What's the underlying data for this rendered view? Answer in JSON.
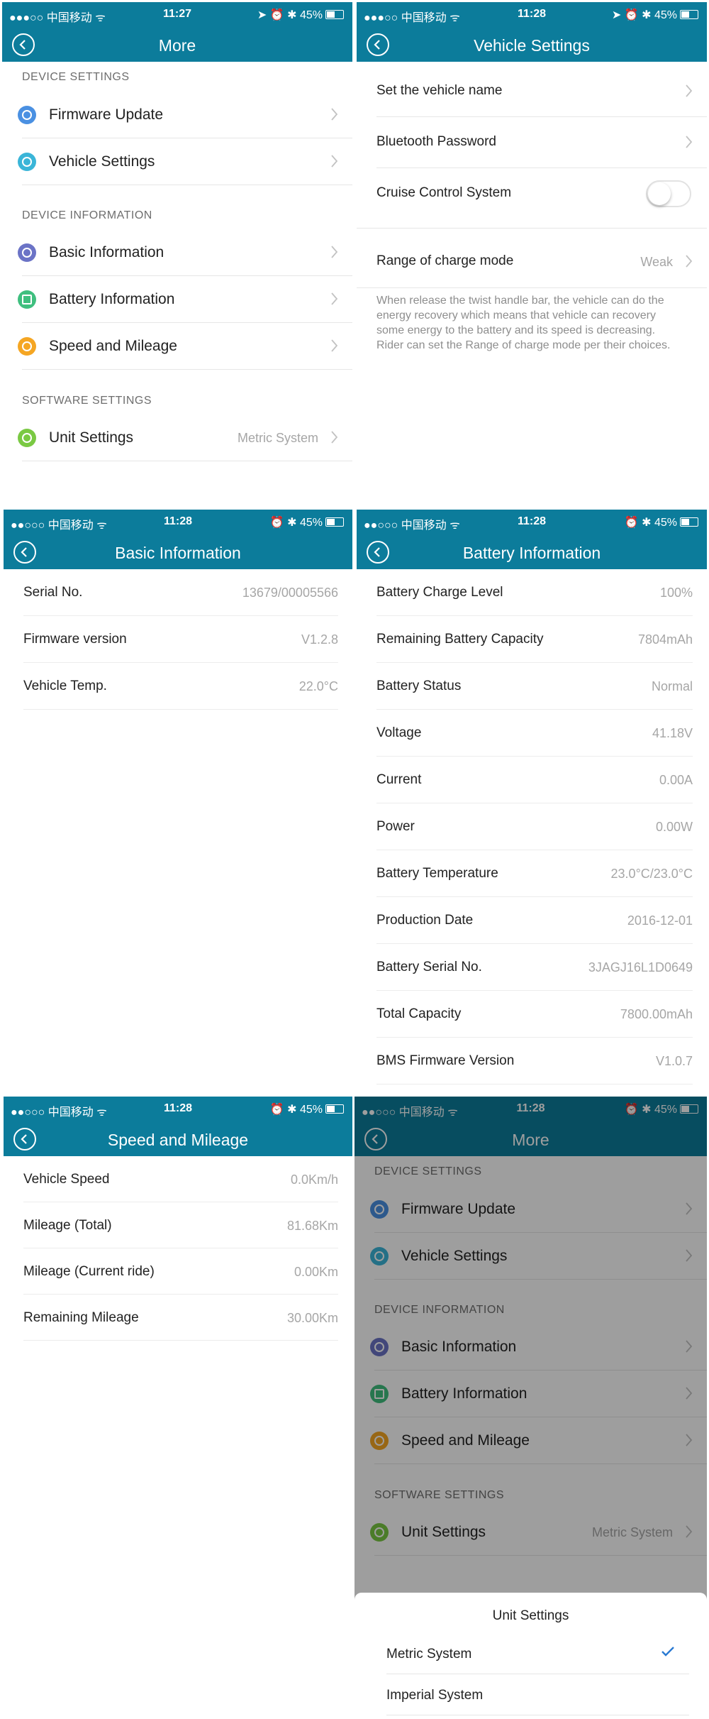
{
  "status_bars": [
    {
      "carrier": "●●●○○ 中国移动 ᯤ",
      "time": "11:27",
      "right": "➤ ⏰ ✱ 45%"
    },
    {
      "carrier": "●●●○○ 中国移动 ᯤ",
      "time": "11:28",
      "right": "➤ ⏰ ✱ 45%"
    },
    {
      "carrier": "●●○○○ 中国移动 ᯤ",
      "time": "11:28",
      "right": "⏰ ✱ 45%"
    },
    {
      "carrier": "●●○○○ 中国移动 ᯤ",
      "time": "11:28",
      "right": "⏰ ✱ 45%"
    },
    {
      "carrier": "●●○○○ 中国移动 ᯤ",
      "time": "11:28",
      "right": "⏰ ✱ 45%"
    },
    {
      "carrier": "●●○○○ 中国移动 ᯤ",
      "time": "11:28",
      "right": "⏰ ✱ 45%"
    }
  ],
  "more": {
    "title": "More",
    "sections": {
      "device_settings": "DEVICE SETTINGS",
      "device_information": "DEVICE INFORMATION",
      "software_settings": "SOFTWARE SETTINGS"
    },
    "items": {
      "firmware_update": "Firmware Update",
      "vehicle_settings": "Vehicle Settings",
      "basic_information": "Basic Information",
      "battery_information": "Battery Information",
      "speed_and_mileage": "Speed and Mileage",
      "unit_settings": "Unit Settings"
    },
    "unit_settings_value": "Metric System",
    "icon_colors": {
      "firmware": "#4a90e2",
      "vehicle": "#3ab5d8",
      "basic": "#6b73c6",
      "battery": "#3fbf7f",
      "speed": "#f5a623",
      "unit": "#7ac943"
    }
  },
  "vehicle_settings": {
    "title": "Vehicle Settings",
    "rows": {
      "vehicle_name": "Set the vehicle name",
      "bluetooth_password": "Bluetooth Password",
      "cruise_control": "Cruise Control System",
      "charge_mode": "Range of charge mode"
    },
    "cruise_control_on": false,
    "charge_mode_value": "Weak",
    "description": "When release the twist handle bar, the vehicle can do the energy recovery which means that vehicle can recovery some energy to the battery and its speed is decreasing. Rider can set the Range of charge mode per their choices."
  },
  "basic_information": {
    "title": "Basic Information",
    "rows": [
      {
        "label": "Serial No.",
        "value": "13679/00005566"
      },
      {
        "label": "Firmware version",
        "value": "V1.2.8"
      },
      {
        "label": "Vehicle Temp.",
        "value": "22.0°C"
      }
    ]
  },
  "battery_information": {
    "title": "Battery Information",
    "rows": [
      {
        "label": "Battery Charge Level",
        "value": "100%"
      },
      {
        "label": "Remaining Battery Capacity",
        "value": "7804mAh"
      },
      {
        "label": "Battery Status",
        "value": "Normal"
      },
      {
        "label": "Voltage",
        "value": "41.18V"
      },
      {
        "label": "Current",
        "value": "0.00A"
      },
      {
        "label": "Power",
        "value": "0.00W"
      },
      {
        "label": "Battery Temperature",
        "value": "23.0°C/23.0°C"
      },
      {
        "label": "Production Date",
        "value": "2016-12-01"
      },
      {
        "label": "Battery Serial No.",
        "value": "3JAGJ16L1D0649"
      },
      {
        "label": "Total Capacity",
        "value": "7800.00mAh"
      },
      {
        "label": "BMS Firmware Version",
        "value": "V1.0.7"
      }
    ]
  },
  "speed_and_mileage": {
    "title": "Speed and Mileage",
    "rows": [
      {
        "label": "Vehicle Speed",
        "value": "0.0Km/h"
      },
      {
        "label": "Mileage (Total)",
        "value": "81.68Km"
      },
      {
        "label": "Mileage (Current ride)",
        "value": "0.00Km"
      },
      {
        "label": "Remaining Mileage",
        "value": "30.00Km"
      }
    ]
  },
  "unit_sheet": {
    "title": "Unit Settings",
    "options": [
      "Metric System",
      "Imperial System"
    ],
    "selected": "Metric System",
    "check_color": "#2a7ad2"
  },
  "battery_level": 0.45
}
